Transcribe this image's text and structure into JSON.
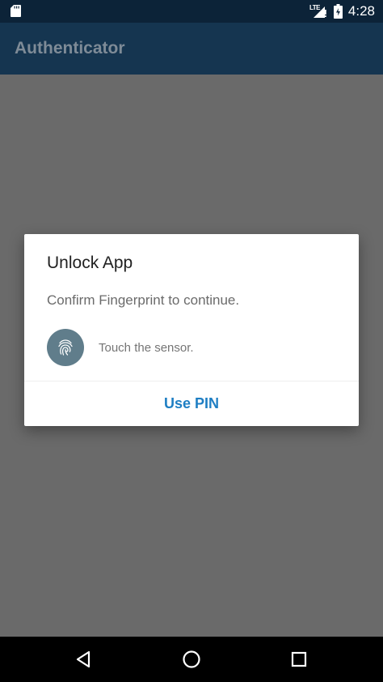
{
  "status_bar": {
    "network_type": "LTE",
    "time": "4:28",
    "icons": [
      "sd-card-icon",
      "signal-icon",
      "battery-icon"
    ]
  },
  "app_bar": {
    "title": "Authenticator"
  },
  "dialog": {
    "title": "Unlock App",
    "message": "Confirm Fingerprint to continue.",
    "fingerprint_icon": "fingerprint-icon",
    "fingerprint_status": "Touch the sensor.",
    "button_label": "Use PIN"
  },
  "nav_bar": {
    "icons": [
      "back-icon",
      "home-icon",
      "recents-icon"
    ]
  },
  "colors": {
    "status_bar": "#0c2338",
    "app_bar": "#153550",
    "scrim_background": "#6a6a6a",
    "accent": "#1e7ec3",
    "fingerprint_circle": "#607d8b"
  }
}
